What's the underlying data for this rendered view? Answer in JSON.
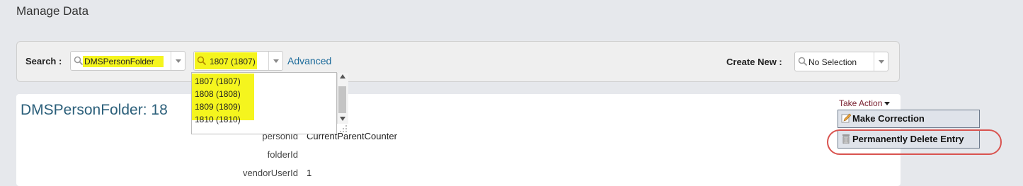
{
  "page": {
    "title": "Manage Data"
  },
  "search": {
    "label": "Search :",
    "type_value": "DMSPersonFolder",
    "record_value": "1807 (1807)",
    "advanced_link": "Advanced",
    "create_label": "Create New :",
    "create_value": "No Selection"
  },
  "record_dropdown": {
    "options": [
      "1807 (1807)",
      "1808 (1808)",
      "1809 (1809)",
      "1810 (1810)"
    ]
  },
  "record": {
    "title": "DMSPersonFolder: 18",
    "fields": [
      {
        "label": "personId",
        "value": "CurrentParentCounter"
      },
      {
        "label": "folderId",
        "value": ""
      },
      {
        "label": "vendorUserId",
        "value": "1"
      }
    ]
  },
  "actions": {
    "take_action_label": "Take Action",
    "make_correction": "Make Correction",
    "permanently_delete": "Permanently Delete Entry"
  },
  "colors": {
    "highlight": "#f5f51e",
    "link": "#1b6a9a",
    "title": "#2b5f7a",
    "annotation_ring": "#d9534f"
  },
  "icons": [
    "search-icon",
    "chevron-down-icon",
    "pencil-icon",
    "trash-icon",
    "resize-grip-icon"
  ]
}
